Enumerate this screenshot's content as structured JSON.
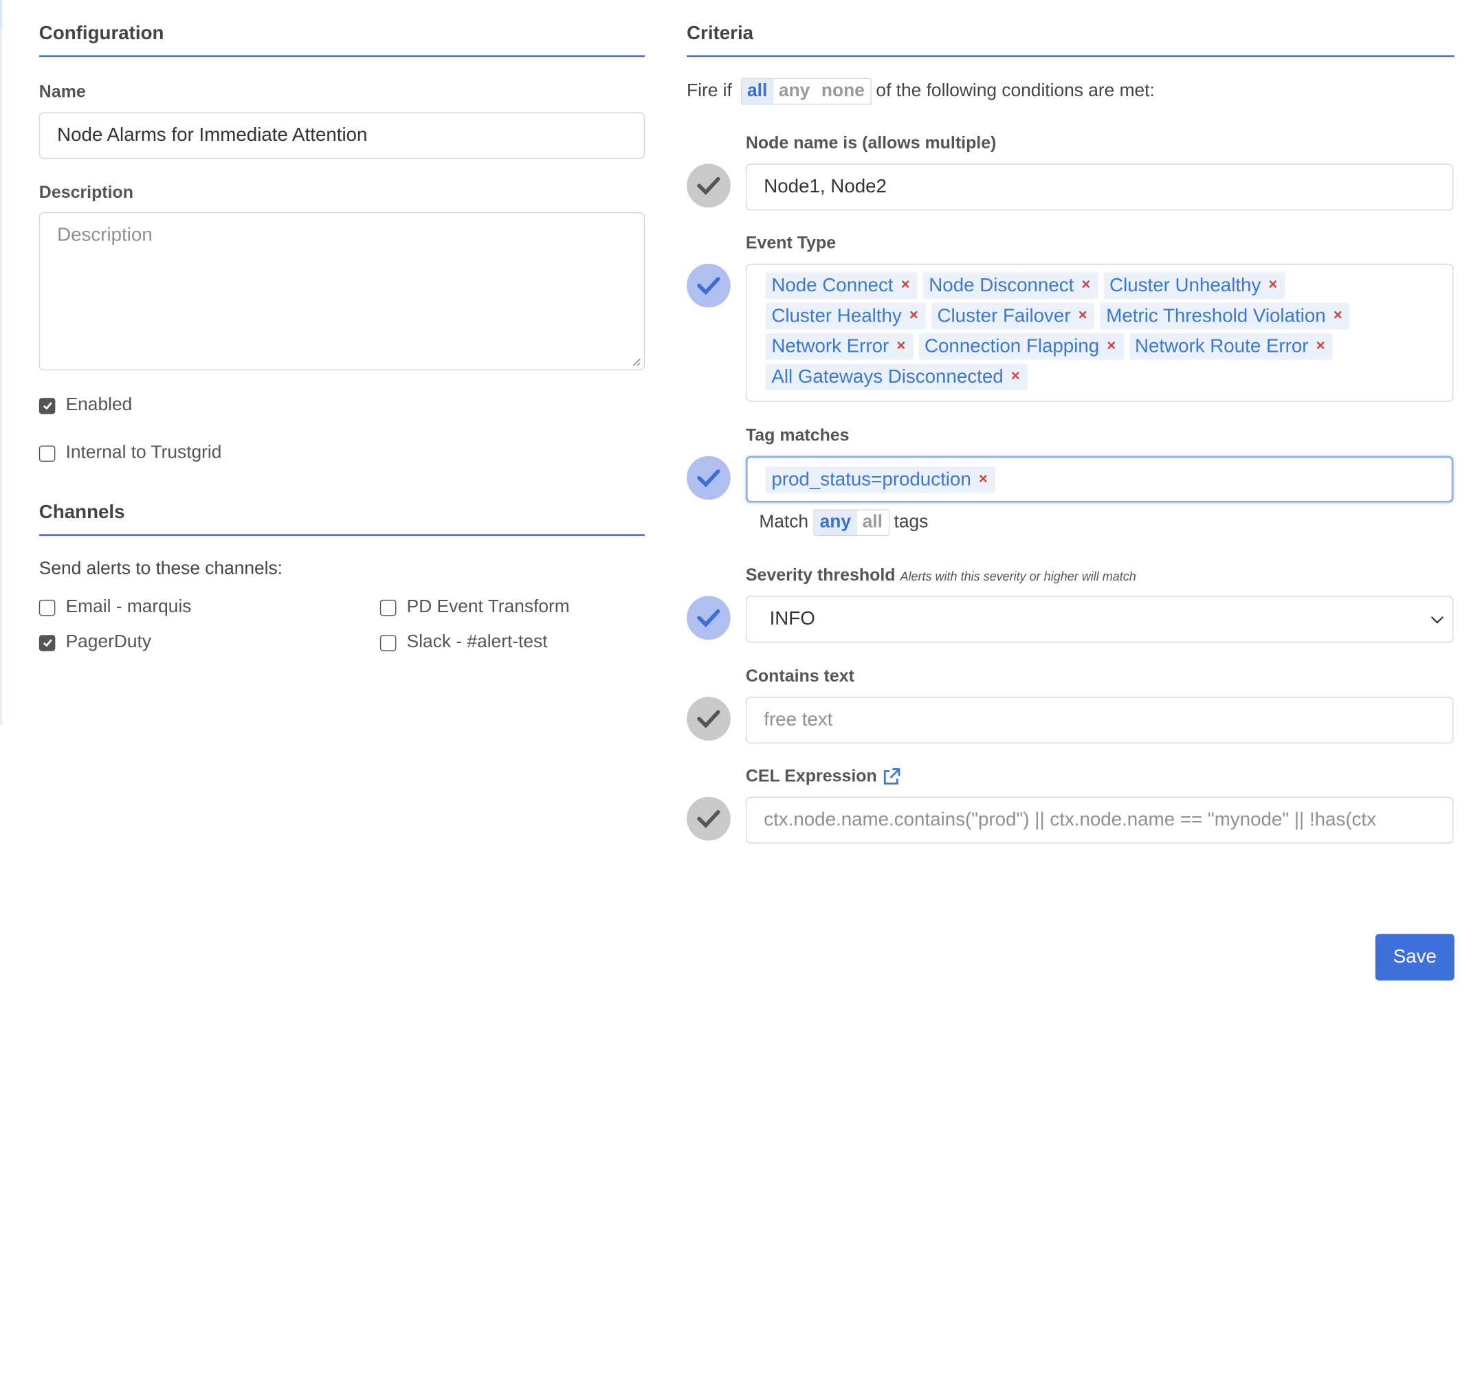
{
  "configuration": {
    "title": "Configuration",
    "name_label": "Name",
    "name_value": "Node Alarms for Immediate Attention",
    "description_label": "Description",
    "description_placeholder": "Description",
    "enabled_label": "Enabled",
    "enabled_checked": true,
    "internal_label": "Internal to Trustgrid",
    "internal_checked": false
  },
  "channels": {
    "title": "Channels",
    "intro": "Send alerts to these channels:",
    "items": [
      {
        "label": "Email - marquis",
        "checked": false
      },
      {
        "label": "PD Event Transform",
        "checked": false
      },
      {
        "label": "PagerDuty",
        "checked": true
      },
      {
        "label": "Slack - #alert-test",
        "checked": false
      }
    ]
  },
  "criteria": {
    "title": "Criteria",
    "fire_prefix": "Fire if",
    "fire_options": [
      "all",
      "any",
      "none"
    ],
    "fire_selected": "all",
    "fire_suffix": "of the following conditions are met:",
    "node_name": {
      "label": "Node name is (allows multiple)",
      "value": "Node1, Node2",
      "active": false
    },
    "event_type": {
      "label": "Event Type",
      "active": true,
      "tags": [
        "Node Connect",
        "Node Disconnect",
        "Cluster Unhealthy",
        "Cluster Healthy",
        "Cluster Failover",
        "Metric Threshold Violation",
        "Network Error",
        "Connection Flapping",
        "Network Route Error",
        "All Gateways Disconnected"
      ],
      "remove_glyph": "×"
    },
    "tag_matches": {
      "label": "Tag matches",
      "active": true,
      "tags": [
        "prod_status=production"
      ],
      "match_prefix": "Match",
      "match_options": [
        "any",
        "all"
      ],
      "match_selected": "any",
      "match_suffix": "tags"
    },
    "severity": {
      "label": "Severity threshold",
      "hint": "Alerts with this severity or higher will match",
      "value": "INFO",
      "active": true
    },
    "contains_text": {
      "label": "Contains text",
      "placeholder": "free text",
      "active": false
    },
    "cel": {
      "label": "CEL Expression",
      "placeholder": "ctx.node.name.contains(\"prod\") || ctx.node.name == \"mynode\" || !has(ctx",
      "active": false
    }
  },
  "save_label": "Save",
  "colors": {
    "accent": "#3f6fd8",
    "tag_text": "#3b78d4",
    "tag_bg": "#ebf1fa",
    "remove_x": "#d43f3a",
    "status_on": "#aebff0",
    "status_off": "#c9c9c9"
  }
}
